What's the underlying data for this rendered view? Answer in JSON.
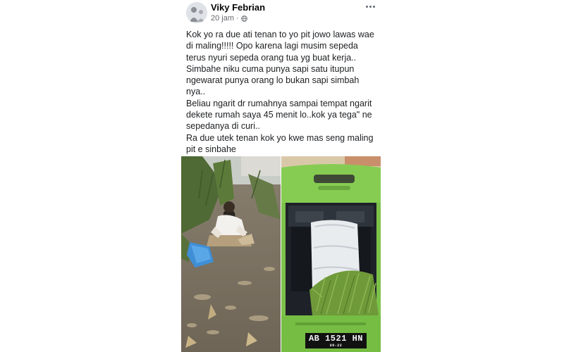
{
  "post": {
    "author": "Viky Febrian",
    "time": "20 jam",
    "separator": "·",
    "privacy_icon": "globe-icon",
    "more_icon": "more-options-icon",
    "text_lines": [
      "Kok yo ra due ati tenan to yo pit jowo lawas wae",
      "di maling!!!!! Opo karena lagi musim sepeda",
      "terus nyuri sepeda orang tua yg buat kerja..",
      "Simbahe niku cuma punya sapi satu itupun",
      "ngewarat punya orang lo bukan sapi simbah",
      "nya..",
      "Beliau ngarit dr rumahnya sampai tempat ngarit",
      "dekete rumah saya 45 menit lo..kok ya tega\" ne",
      "sepedanya di curi..",
      "Ra due utek tenan kok yo kwe mas seng maling",
      "pit e sinbahe"
    ]
  },
  "photos": {
    "right": {
      "plate_number": "AB 1521 HN",
      "plate_sub": "08-22"
    }
  },
  "colors": {
    "car": "#7cc24a",
    "grass": "#6f9a3a",
    "text": "#1c1e21",
    "meta": "#65676b"
  }
}
